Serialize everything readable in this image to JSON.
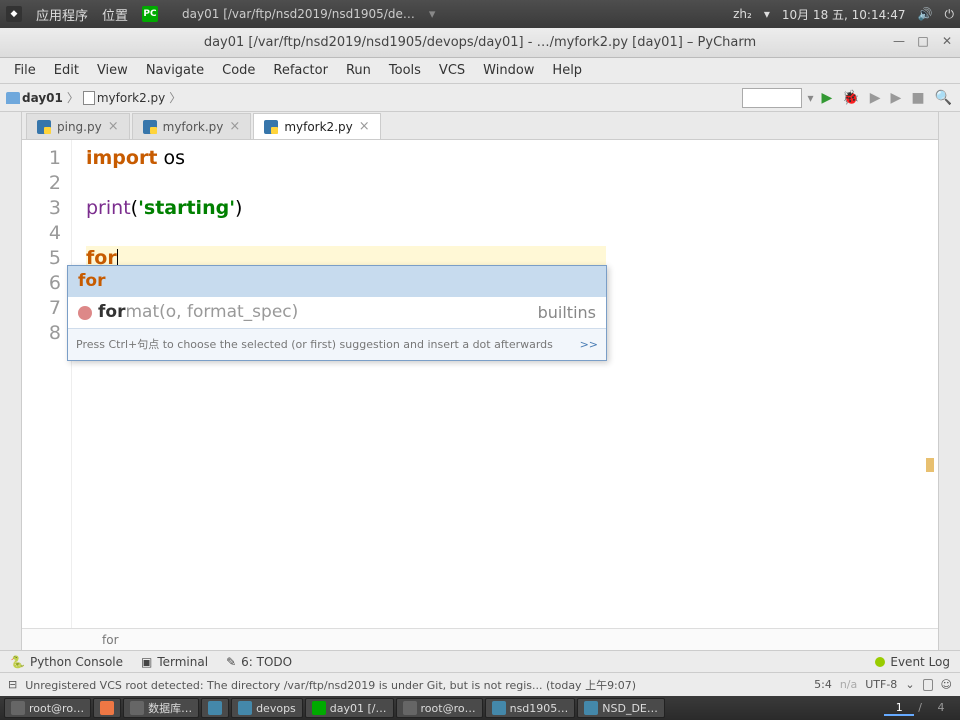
{
  "sysbar": {
    "apps": "应用程序",
    "places": "位置",
    "title": "day01 [/var/ftp/nsd2019/nsd1905/de…",
    "im": "zh₂",
    "date": "10月 18 五, 10:14:47"
  },
  "window": {
    "title": "day01 [/var/ftp/nsd2019/nsd1905/devops/day01] - …/myfork2.py [day01] – PyCharm"
  },
  "menus": [
    "File",
    "Edit",
    "View",
    "Navigate",
    "Code",
    "Refactor",
    "Run",
    "Tools",
    "VCS",
    "Window",
    "Help"
  ],
  "breadcrumb": {
    "folder": "day01",
    "file": "myfork2.py"
  },
  "tabs": [
    {
      "name": "ping.py",
      "active": false
    },
    {
      "name": "myfork.py",
      "active": false
    },
    {
      "name": "myfork2.py",
      "active": true
    }
  ],
  "code": {
    "lines": [
      "1",
      "2",
      "3",
      "4",
      "5",
      "6",
      "7",
      "8"
    ],
    "l1_import": "import",
    "l1_os": " os",
    "l3_print": "print",
    "l3_paren_open": "(",
    "l3_str": "'starting'",
    "l3_paren_close": ")",
    "l5_for": "for"
  },
  "popup": {
    "item1": "for",
    "item2_match": "for",
    "item2_rest": "mat",
    "item2_params": "(o, format_spec)",
    "item2_origin": "builtins",
    "hint": "Press Ctrl+句点 to choose the selected (or first) suggestion and insert a dot afterwards",
    "hint_link": ">>"
  },
  "editor_foot": "for",
  "toolwindows": {
    "console": "Python Console",
    "terminal": "Terminal",
    "todo": "6: TODO",
    "eventlog": "Event Log"
  },
  "status": {
    "msg": "Unregistered VCS root detected: The directory /var/ftp/nsd2019 is under Git, but is not regis...",
    "time": "(today 上午9:07)",
    "pos": "5:4",
    "na": "n/a",
    "enc": "UTF-8"
  },
  "taskbar": {
    "items": [
      "root@ro…",
      "",
      "数据库…",
      "",
      "devops",
      "",
      "day01 [/…",
      "",
      "root@ro…",
      "",
      "nsd1905…",
      "",
      "NSD_DE…"
    ],
    "desks": [
      "1",
      "/",
      "4"
    ]
  }
}
